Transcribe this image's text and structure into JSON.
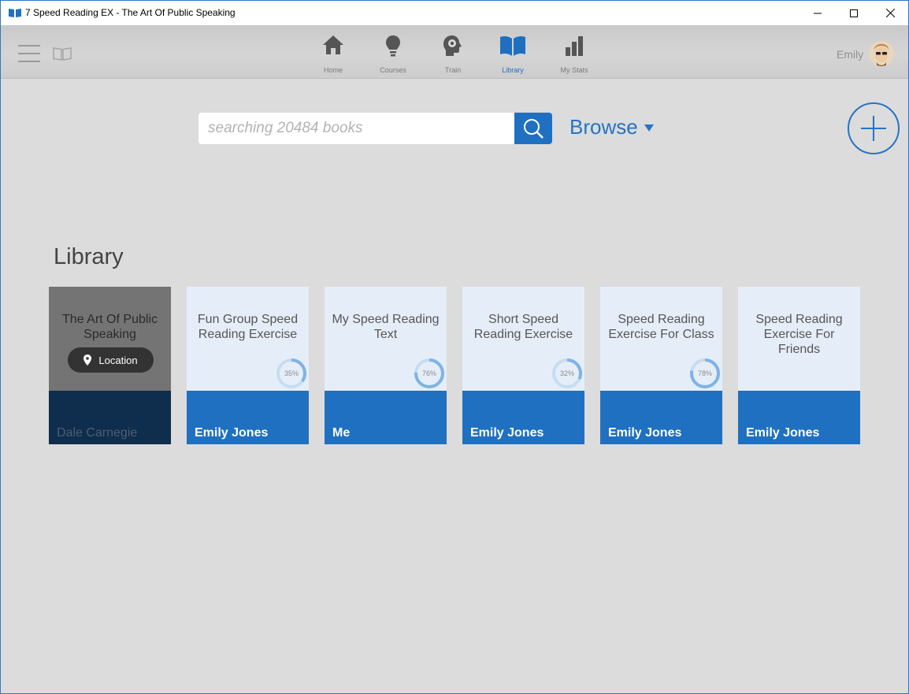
{
  "window": {
    "title": "7 Speed Reading EX - The Art Of Public Speaking"
  },
  "nav": {
    "items": [
      {
        "label": "Home",
        "icon": "home-icon",
        "active": false
      },
      {
        "label": "Courses",
        "icon": "lightbulb-icon",
        "active": false
      },
      {
        "label": "Train",
        "icon": "brain-gear-icon",
        "active": false
      },
      {
        "label": "Library",
        "icon": "book-icon",
        "active": true
      },
      {
        "label": "My Stats",
        "icon": "bar-chart-icon",
        "active": false
      }
    ]
  },
  "user": {
    "name": "Emily"
  },
  "search": {
    "placeholder": "searching 20484 books",
    "value": ""
  },
  "browse": {
    "label": "Browse"
  },
  "library": {
    "title": "Library",
    "books": [
      {
        "title": "The Art Of Public Speaking",
        "author": "Dale Carnegie",
        "current": true,
        "action_label": "Location"
      },
      {
        "title": "Fun Group Speed Reading Exercise",
        "author": "Emily Jones",
        "progress": 35,
        "progress_label": "35%"
      },
      {
        "title": "My Speed Reading Text",
        "author": "Me",
        "progress": 76,
        "progress_label": "76%"
      },
      {
        "title": "Short Speed Reading Exercise",
        "author": "Emily Jones",
        "progress": 32,
        "progress_label": "32%"
      },
      {
        "title": "Speed Reading Exercise For Class",
        "author": "Emily Jones",
        "progress": 78,
        "progress_label": "78%"
      },
      {
        "title": "Speed Reading Exercise For Friends",
        "author": "Emily Jones"
      }
    ]
  },
  "colors": {
    "accent": "#1f70c1",
    "current_cover": "#747474",
    "current_footer": "#0f2d4c",
    "card_cover": "#e5eef8",
    "progress_track": "#c7dcf1",
    "progress_fill": "#7fb3e6"
  }
}
